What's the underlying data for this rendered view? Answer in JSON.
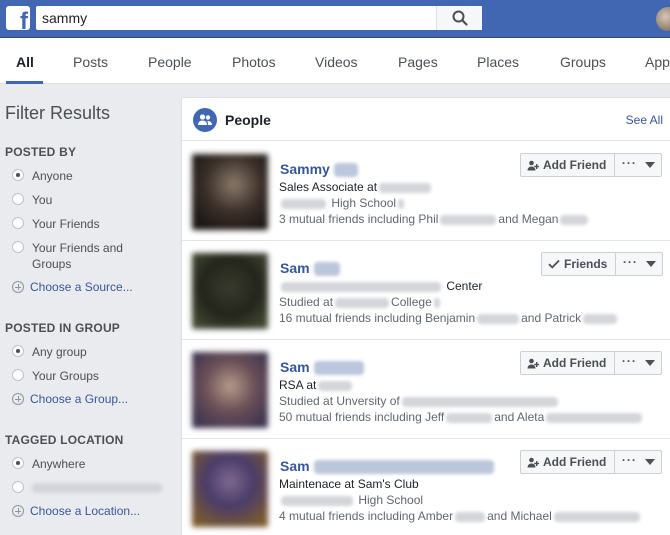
{
  "topbar": {
    "logo_letter": "f",
    "search_value": "sammy"
  },
  "tabs": [
    {
      "label": "All"
    },
    {
      "label": "Posts"
    },
    {
      "label": "People"
    },
    {
      "label": "Photos"
    },
    {
      "label": "Videos"
    },
    {
      "label": "Pages"
    },
    {
      "label": "Places"
    },
    {
      "label": "Groups"
    },
    {
      "label": "Apps"
    }
  ],
  "sidebar": {
    "title": "Filter Results",
    "posted_by": {
      "heading": "POSTED BY",
      "options": [
        "Anyone",
        "You",
        "Your Friends",
        "Your Friends and Groups"
      ],
      "choose": "Choose a Source..."
    },
    "posted_in_group": {
      "heading": "POSTED IN GROUP",
      "options": [
        "Any group",
        "Your Groups"
      ],
      "choose": "Choose a Group..."
    },
    "tagged_location": {
      "heading": "TAGGED LOCATION",
      "options": [
        "Anywhere"
      ],
      "choose": "Choose a Location..."
    }
  },
  "people": {
    "title": "People",
    "see_all": "See All",
    "results": [
      {
        "name": "Sammy",
        "action": "Add Friend",
        "line1": "Sales Associate at",
        "line2_suffix": "High School",
        "line3_prefix": "3 mutual friends including Phil",
        "line3_mid": "and Megan"
      },
      {
        "name": "Sam",
        "action": "Friends",
        "line1_suffix": "Center",
        "line2_prefix": "Studied at",
        "line2_suffix": "College",
        "line3_prefix": "16 mutual friends including Benjamin",
        "line3_mid": "and Patrick"
      },
      {
        "name": "Sam",
        "action": "Add Friend",
        "line1": "RSA at",
        "line2_prefix": "Studied at Unversity of",
        "line3_prefix": "50 mutual friends including Jeff",
        "line3_mid": "and Aleta"
      },
      {
        "name": "Sam",
        "action": "Add Friend",
        "line1": "Maintenace at Sam's Club",
        "line2_suffix": "High School",
        "line3_prefix": "4 mutual friends including Amber",
        "line3_mid": "and Michael"
      }
    ]
  },
  "colors": {
    "brand_blue": "#4267b2",
    "link_blue": "#365899",
    "page_bg": "#e9ebee"
  }
}
